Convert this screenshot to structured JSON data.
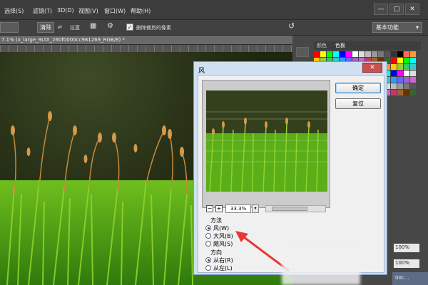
{
  "menubar": {
    "items": [
      "选择(S)",
      "滤镜(T)",
      "3D(D)",
      "视图(V)",
      "窗口(W)",
      "帮助(H)"
    ],
    "window_buttons": [
      "—",
      "□",
      "✕"
    ]
  },
  "options": {
    "refine_label": "清除",
    "straighten_label": "拉直",
    "delete_cropped_label": "删除裁剪的像素",
    "delete_cropped_checked": true,
    "workspace_label": "基本功能"
  },
  "document": {
    "tab_title": "7.1% (x_large_9LtX_260f0000cc981269_RGB/8) *"
  },
  "panels": {
    "tabs": [
      "颜色",
      "色板"
    ],
    "opacity_pct": "100%",
    "fill_pct": "100%",
    "layer_label": "00c..."
  },
  "dialog": {
    "title": "风",
    "close_label": "✕",
    "ok_label": "确定",
    "reset_label": "复位",
    "zoom_value": "33.3%",
    "zoom_minus": "−",
    "zoom_plus": "+",
    "method": {
      "label": "方法",
      "options": [
        "风(W)",
        "大风(B)",
        "飓风(S)"
      ],
      "selected": "风(W)"
    },
    "direction": {
      "label": "方向",
      "options": [
        "从右(R)",
        "从左(L)"
      ],
      "selected": "从右(R)"
    }
  },
  "colors": {
    "accent_arrow": "#e53935",
    "dialog_bg": "#cfe0f1"
  }
}
